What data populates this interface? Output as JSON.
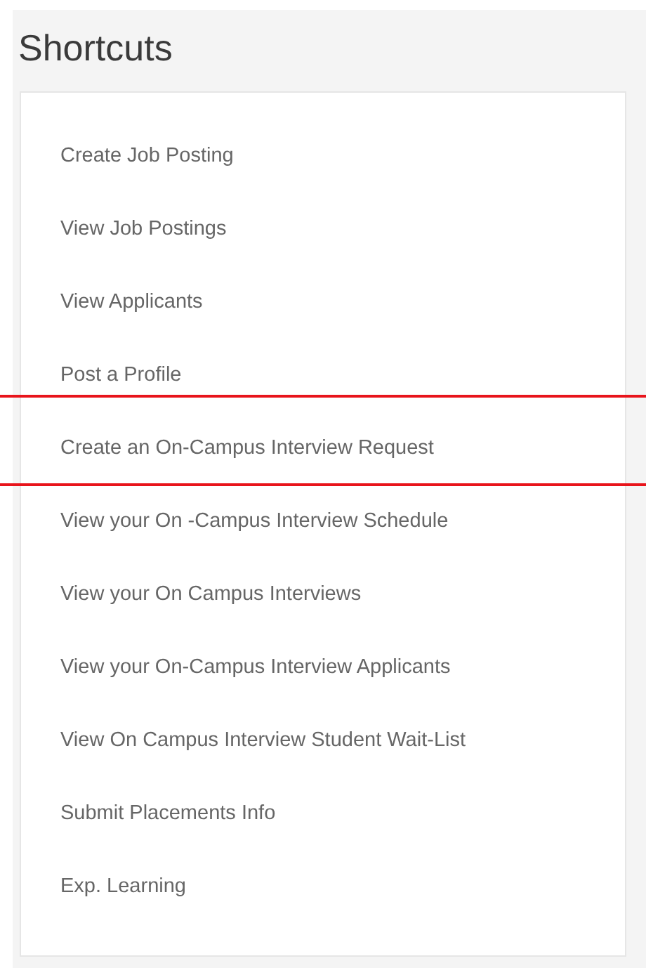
{
  "title": "Shortcuts",
  "shortcuts": [
    {
      "label": "Create Job Posting",
      "highlighted": false
    },
    {
      "label": "View Job Postings",
      "highlighted": false
    },
    {
      "label": "View Applicants",
      "highlighted": false
    },
    {
      "label": "Post a Profile",
      "highlighted": false
    },
    {
      "label": "Create an On-Campus Interview Request",
      "highlighted": true
    },
    {
      "label": "View your On -Campus Interview Schedule",
      "highlighted": false
    },
    {
      "label": "View your On Campus Interviews",
      "highlighted": false
    },
    {
      "label": "View your On-Campus Interview Applicants",
      "highlighted": false
    },
    {
      "label": "View On Campus Interview Student Wait-List",
      "highlighted": false
    },
    {
      "label": "Submit Placements Info",
      "highlighted": false
    },
    {
      "label": "Exp. Learning",
      "highlighted": false
    }
  ]
}
